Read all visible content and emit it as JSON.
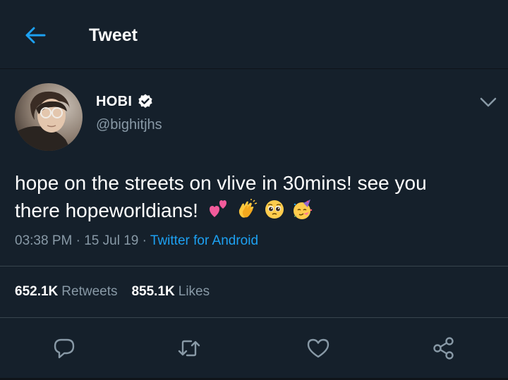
{
  "header": {
    "title": "Tweet",
    "back_icon": "back-arrow-icon"
  },
  "tweet": {
    "author_name": "HOBI",
    "author_handle": "@bighitjhs",
    "verified": true,
    "text_line1": "hope on the streets on vlive in 30mins! see you",
    "text_line2": "there hopeworldians!",
    "emojis": [
      "two-hearts-emoji",
      "clapping-hands-emoji",
      "pleading-face-emoji",
      "partying-face-emoji"
    ],
    "time": "03:38 PM",
    "date": "15 Jul 19",
    "source": "Twitter for Android",
    "separator": " · "
  },
  "stats": {
    "retweets_count": "652.1K",
    "retweets_label": "Retweets",
    "likes_count": "855.1K",
    "likes_label": "Likes"
  },
  "actions": [
    "reply-icon",
    "retweet-icon",
    "like-icon",
    "share-icon"
  ],
  "colors": {
    "background": "#15202b",
    "accent": "#1da1f2",
    "secondary_text": "#8899a6",
    "divider": "#38444d"
  }
}
